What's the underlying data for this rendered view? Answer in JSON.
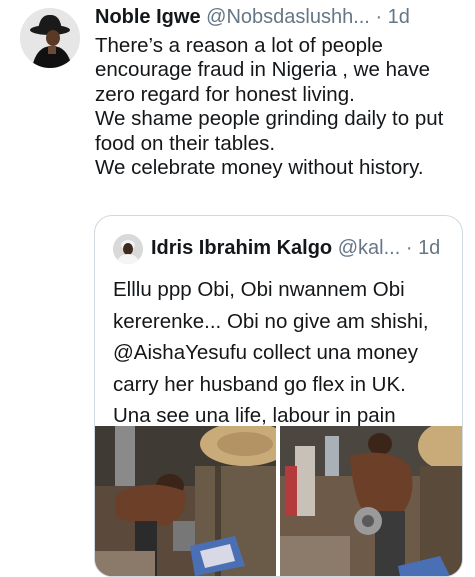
{
  "tweet": {
    "author_name": "Noble Igwe",
    "author_handle": "@Nobsdaslushh...",
    "separator": "·",
    "time": "1d",
    "text_lines": [
      "There’s a reason a lot of people",
      "encourage fraud in Nigeria , we have",
      "zero regard for honest living.",
      "We shame people grinding daily to put",
      "food on their tables.",
      "We celebrate money without history."
    ]
  },
  "quoted_tweet": {
    "author_name": "Idris Ibrahim Kalgo",
    "author_handle": "@kal...",
    "separator": "·",
    "time": "1d",
    "text_lines": [
      "Elllu ppp Obi, Obi nwannem Obi",
      "kererenke... Obi no give am shishi,",
      "@AishaYesufu collect una money",
      "carry her husband go flex in UK.",
      "Una see una life, labour in pain"
    ],
    "media": [
      "photo-1",
      "photo-2"
    ]
  },
  "icons": [
    "avatar-noble-igwe",
    "avatar-idris-kalgo"
  ],
  "colors": {
    "text": "#14171a",
    "secondary": "#657786",
    "border": "#cfd9de"
  }
}
